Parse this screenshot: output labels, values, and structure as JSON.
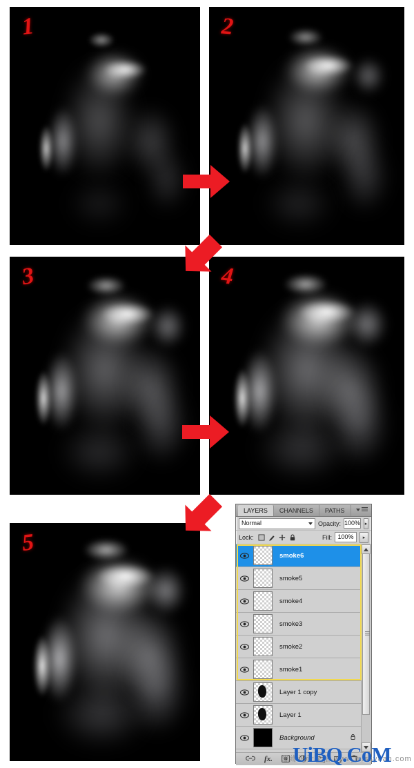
{
  "tutorial": {
    "steps": [
      {
        "number": "1",
        "caption": "smoke portrait step 1"
      },
      {
        "number": "2",
        "caption": "smoke portrait step 2"
      },
      {
        "number": "3",
        "caption": "smoke portrait step 3"
      },
      {
        "number": "4",
        "caption": "smoke portrait step 4"
      },
      {
        "number": "5",
        "caption": "smoke portrait step 5"
      }
    ],
    "arrows": [
      {
        "name": "arrow-1-to-2",
        "direction": "right"
      },
      {
        "name": "arrow-2-to-3",
        "direction": "down-left"
      },
      {
        "name": "arrow-3-to-4",
        "direction": "right"
      },
      {
        "name": "arrow-4-to-5",
        "direction": "down-left"
      }
    ]
  },
  "layers_panel": {
    "tabs": [
      {
        "label": "LAYERS",
        "active": true
      },
      {
        "label": "CHANNELS",
        "active": false
      },
      {
        "label": "PATHS",
        "active": false
      }
    ],
    "blend_mode": "Normal",
    "opacity_label": "Opacity:",
    "opacity_value": "100%",
    "lock_label": "Lock:",
    "fill_label": "Fill:",
    "fill_value": "100%",
    "lock_icons": [
      "lock-transparent-pixels-icon",
      "lock-image-pixels-icon",
      "lock-position-icon",
      "lock-all-icon"
    ],
    "layers": [
      {
        "name": "smoke6",
        "selected": true,
        "thumb": "transparent",
        "visible": true,
        "locked": false
      },
      {
        "name": "smoke5",
        "selected": false,
        "thumb": "transparent",
        "visible": true,
        "locked": false
      },
      {
        "name": "smoke4",
        "selected": false,
        "thumb": "transparent",
        "visible": true,
        "locked": false
      },
      {
        "name": "smoke3",
        "selected": false,
        "thumb": "transparent",
        "visible": true,
        "locked": false
      },
      {
        "name": "smoke2",
        "selected": false,
        "thumb": "transparent",
        "visible": true,
        "locked": false
      },
      {
        "name": "smoke1",
        "selected": false,
        "thumb": "transparent",
        "visible": true,
        "locked": false
      },
      {
        "name": "Layer 1 copy",
        "selected": false,
        "thumb": "blob",
        "visible": true,
        "locked": false
      },
      {
        "name": "Layer 1",
        "selected": false,
        "thumb": "blob",
        "visible": true,
        "locked": false
      },
      {
        "name": "Background",
        "selected": false,
        "thumb": "black",
        "visible": true,
        "locked": true
      }
    ],
    "footer_icons": [
      "link-layers-icon",
      "layer-style-fx-icon",
      "add-layer-mask-icon",
      "new-adjustment-layer-icon",
      "new-group-icon",
      "new-layer-icon",
      "delete-layer-icon"
    ],
    "selection_color": "#1e90e8",
    "group_outline_color": "#f2d94e",
    "scrollbar": {
      "name": "layers-scrollbar"
    }
  },
  "watermark": {
    "text": "UiBQ.CoM",
    "sub_text": "思缘设计论坛 www.missyuan.com",
    "color": "#1f5fbf"
  }
}
